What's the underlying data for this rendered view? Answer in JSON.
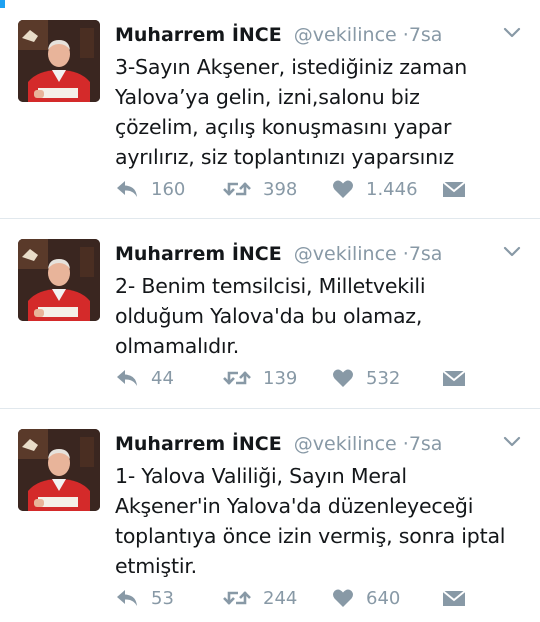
{
  "tweets": [
    {
      "author_name": "Muharrem İNCE",
      "handle": "@vekilince",
      "separator": "·",
      "time": "7sa",
      "text": "3-Sayın Akşener, istediğiniz zaman\nYalova’ya gelin, izni,salonu biz\nçözelim, açılış konuşmasını yapar\nayrılırız, siz toplantınızı yaparsınız",
      "replies": "160",
      "retweets": "398",
      "likes": "1.446"
    },
    {
      "author_name": "Muharrem İNCE",
      "handle": "@vekilince",
      "separator": "·",
      "time": "7sa",
      "text": "2- Benim temsilcisi, Milletvekili\nolduğum Yalova'da bu olamaz,\nolmamalıdır.",
      "replies": "44",
      "retweets": "139",
      "likes": "532"
    },
    {
      "author_name": "Muharrem İNCE",
      "handle": "@vekilince",
      "separator": "·",
      "time": "7sa",
      "text": "1- Yalova Valiliği, Sayın Meral\nAkşener'in Yalova'da düzenleyeceği\ntoplantıya önce izin vermiş, sonra iptal\netmiştir.",
      "replies": "53",
      "retweets": "244",
      "likes": "640"
    }
  ],
  "icons": {
    "reply": "reply-icon",
    "retweet": "retweet-icon",
    "like": "heart-icon",
    "direct_message": "envelope-icon",
    "menu": "chevron-down-icon"
  },
  "colors": {
    "accent": "#1da1f2",
    "text": "#14171a",
    "secondary": "#8899a6",
    "divider": "#e1e8ed"
  }
}
